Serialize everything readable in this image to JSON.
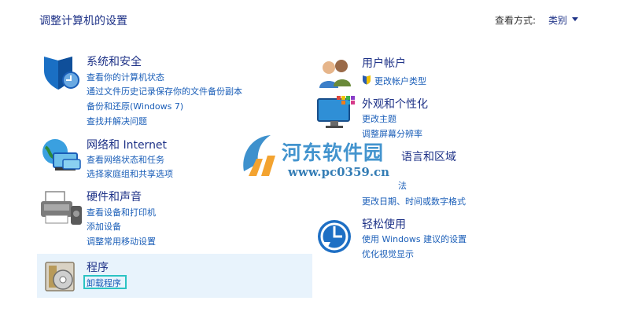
{
  "header": {
    "title": "调整计算机的设置",
    "view_by_label": "查看方式:",
    "view_by_value": "类别"
  },
  "left": {
    "system": {
      "title": "系统和安全",
      "links": [
        "查看你的计算机状态",
        "通过文件历史记录保存你的文件备份副本",
        "备份和还原(Windows 7)",
        "查找并解决问题"
      ]
    },
    "network": {
      "title": "网络和 Internet",
      "links": [
        "查看网络状态和任务",
        "选择家庭组和共享选项"
      ]
    },
    "hardware": {
      "title": "硬件和声音",
      "links": [
        "查看设备和打印机",
        "添加设备",
        "调整常用移动设置"
      ]
    },
    "programs": {
      "title": "程序",
      "links": [
        "卸载程序"
      ]
    }
  },
  "right": {
    "users": {
      "title": "用户帐户",
      "links": [
        "更改帐户类型"
      ]
    },
    "appearance": {
      "title": "外观和个性化",
      "links": [
        "更改主题",
        "调整屏幕分辨率"
      ]
    },
    "clock": {
      "title": "语言和区域",
      "links": [
        "法",
        "更改日期、时间或数字格式"
      ]
    },
    "ease": {
      "title": "轻松使用",
      "links": [
        "使用 Windows 建议的设置",
        "优化视觉显示"
      ]
    }
  },
  "watermark": {
    "brand": "河东软件园",
    "url": "www.pc0359.cn"
  },
  "colors": {
    "title_blue": "#1e3287",
    "link_blue": "#1a5eb8",
    "highlight_bg": "#e8f3fc",
    "focus_border": "#2bc3c3"
  }
}
